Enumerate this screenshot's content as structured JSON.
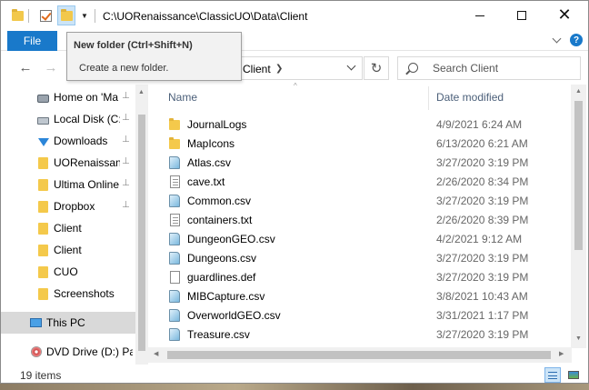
{
  "window": {
    "title": "C:\\UORenaissance\\ClassicUO\\Data\\Client",
    "minimize_icon": "minimize-icon",
    "maximize_icon": "maximize-icon",
    "close_glyph": "✕"
  },
  "ribbon": {
    "file_tab": "File",
    "help_label": "?"
  },
  "tooltip": {
    "title": "New folder (Ctrl+Shift+N)",
    "description": "Create a new folder."
  },
  "address": {
    "crumb": "Client",
    "back_glyph": "←",
    "forward_glyph": "→",
    "refresh_glyph": "↻"
  },
  "search": {
    "placeholder": "Search Client"
  },
  "sidebar": {
    "items": [
      {
        "label": "Home on 'Ma",
        "icon": "home-drive-icon",
        "pinned": true
      },
      {
        "label": "Local Disk (C:)",
        "icon": "drive-icon",
        "pinned": true
      },
      {
        "label": "Downloads",
        "icon": "download-icon",
        "pinned": true
      },
      {
        "label": "UORenaissanc",
        "icon": "folder-icon",
        "pinned": true
      },
      {
        "label": "Ultima Online",
        "icon": "folder-icon",
        "pinned": true
      },
      {
        "label": "Dropbox",
        "icon": "folder-icon",
        "pinned": true
      },
      {
        "label": "Client",
        "icon": "folder-icon",
        "pinned": false
      },
      {
        "label": "Client",
        "icon": "folder-icon",
        "pinned": false
      },
      {
        "label": "CUO",
        "icon": "folder-icon",
        "pinned": false
      },
      {
        "label": "Screenshots",
        "icon": "folder-icon",
        "pinned": false
      },
      {
        "label": "This PC",
        "icon": "computer-icon",
        "pinned": false
      },
      {
        "label": "DVD Drive (D:) Par",
        "icon": "dvd-drive-icon",
        "pinned": false
      }
    ],
    "pin_glyph": "📌"
  },
  "columns": {
    "name": "Name",
    "date_modified": "Date modified"
  },
  "files": [
    {
      "name": "JournalLogs",
      "date": "4/9/2021 6:24 AM",
      "type": "folder"
    },
    {
      "name": "MapIcons",
      "date": "6/13/2020 6:21 AM",
      "type": "folder"
    },
    {
      "name": "Atlas.csv",
      "date": "3/27/2020 3:19 PM",
      "type": "csv"
    },
    {
      "name": "cave.txt",
      "date": "2/26/2020 8:34 PM",
      "type": "txt"
    },
    {
      "name": "Common.csv",
      "date": "3/27/2020 3:19 PM",
      "type": "csv"
    },
    {
      "name": "containers.txt",
      "date": "2/26/2020 8:39 PM",
      "type": "txt"
    },
    {
      "name": "DungeonGEO.csv",
      "date": "4/2/2021 9:12 AM",
      "type": "csv"
    },
    {
      "name": "Dungeons.csv",
      "date": "3/27/2020 3:19 PM",
      "type": "csv"
    },
    {
      "name": "guardlines.def",
      "date": "3/27/2020 3:19 PM",
      "type": "def"
    },
    {
      "name": "MIBCapture.csv",
      "date": "3/8/2021 10:43 AM",
      "type": "csv"
    },
    {
      "name": "OverworldGEO.csv",
      "date": "3/31/2021 1:17 PM",
      "type": "csv"
    },
    {
      "name": "Treasure.csv",
      "date": "3/27/2020 3:19 PM",
      "type": "csv"
    }
  ],
  "status": {
    "item_count": "19 items"
  },
  "colors": {
    "accent": "#1979ca",
    "header_text": "#4c607a",
    "selection": "#d9d9d9",
    "folder": "#f4c94b"
  }
}
